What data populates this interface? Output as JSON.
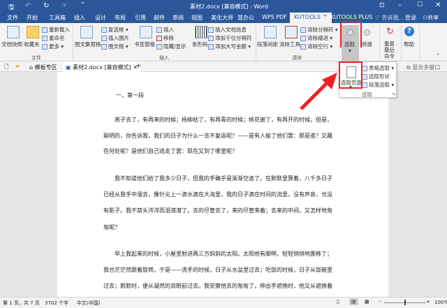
{
  "title": "素材2.docx [兼容模式] - Word",
  "menu_tabs": [
    "文件",
    "开始",
    "工具箱",
    "插入",
    "设计",
    "布局",
    "引用",
    "邮件",
    "审阅",
    "视图",
    "美化大师",
    "慧办公",
    "WPS PDF",
    "KUTOOLS ™",
    "KUTOOLS PLUS"
  ],
  "tell_me": "告诉我...",
  "login": "登录",
  "share": "共享",
  "ribbon": {
    "doc_snapshot": "文档快照",
    "favorites": "收藏夹",
    "reload": "重新载入",
    "rename": "重命名",
    "more": "更多",
    "image_pane": "图文集窗格",
    "checkbox": "复选框",
    "insert_picture": "插入图片",
    "frame": "图文框",
    "bookmark_pane": "书签窗格",
    "insert": "插入",
    "remove": "移除",
    "hide_show": "隐藏/显示",
    "barcode": "条形码",
    "insert_docinfo": "插入文档信息",
    "add_thousand_sep": "添加千位分隔符",
    "add_capital_amount": "添加大写金额",
    "para_spacing": "段落间距",
    "clear_tools": "清除工具",
    "clear_separators": "清除分隔符",
    "clear_indent": "清除缩进",
    "clear_blank_lines": "清除空行",
    "select": "选取",
    "convert": "转换",
    "repeat_last": "重复最后命令",
    "help": "帮助",
    "groups": {
      "file": "文件",
      "insert": "插入",
      "clear": "清除",
      "repeat": "重复",
      "help": "帮助"
    }
  },
  "dropdown": {
    "select_page": "选取页面",
    "table_select": "表格选取",
    "select_shapes": "选取形状",
    "para_select": "段落选取",
    "group": "选取"
  },
  "doc_tabs": {
    "template": "模板专区",
    "document": "素材2.docx [兼容模式]",
    "multi_window": "显示多窗口"
  },
  "document": {
    "heading": "一、第一段",
    "lines": [
      "燕子去了，有再来的时候；杨柳枯了，有再青的时候；桃花谢了，有再开的时候。但是，",
      "聪明的，你告诉我，我们的日子为什么一去不复返呢？——是有人偷了他们罢：那是谁？又藏",
      "在何处呢？是他们自己逃走了罢：现在又到了哪里呢？",
      "我不知道他们给了我多少日子，但我的手确乎是渐渐空虚了。在默默里算着，八千多日子",
      "已经从我手中溜去，像针尖上一滴水滴在大海里，我的日子滴在时间的流里，没有声音，也没",
      "有影子。我不禁头涔涔而泪潸潸了。去的尽管去了，来的尽管来着；去来的中间，又怎样地匆",
      "匆呢？",
      "早上我起来的时候，小屋里射进两三方斜斜的太阳。太阳他有脚啊，轻轻悄悄地挪移了；",
      "我也茫茫然跟着旋转。于是——洗手的时候，日子从水盆里过去；吃饭的时候，日子从饭碗里",
      "过去；默默时，便从凝然的双眼前过去。我觉察他去的匆匆了，伸出手遮挽时，他又从遮挽着"
    ]
  },
  "status": {
    "page": "第 1 页，共 7 页",
    "words": "3702 个字",
    "language": "中文(中国)",
    "zoom": "100%"
  },
  "colors": {
    "brand": "#2b579a",
    "highlight": "#e22222"
  }
}
